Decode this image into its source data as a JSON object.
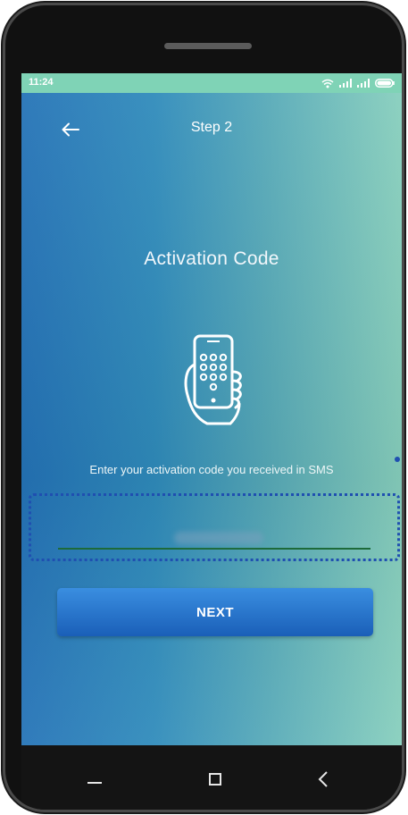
{
  "status_bar": {
    "time": "11:24",
    "icons": [
      "wifi-icon",
      "signal-icon",
      "signal-icon",
      "battery-icon"
    ]
  },
  "app_bar": {
    "back_icon": "arrow-left-icon",
    "title": "Step 2"
  },
  "main": {
    "headline": "Activation Code",
    "illustration": "hand-holding-phone-keypad-icon",
    "instruction": "Enter your activation code you received in SMS",
    "code_input": {
      "value": "",
      "placeholder": ""
    },
    "next_label": "NEXT"
  },
  "nav_bar": {
    "items": [
      "menu-icon",
      "home-icon",
      "back-icon"
    ]
  },
  "colors": {
    "gradient_start": "#2473b7",
    "gradient_end": "#87cfbd",
    "status_bar": "#7fd3b6",
    "button": "#1a5fb8",
    "highlight_border": "#1f4fb0"
  }
}
